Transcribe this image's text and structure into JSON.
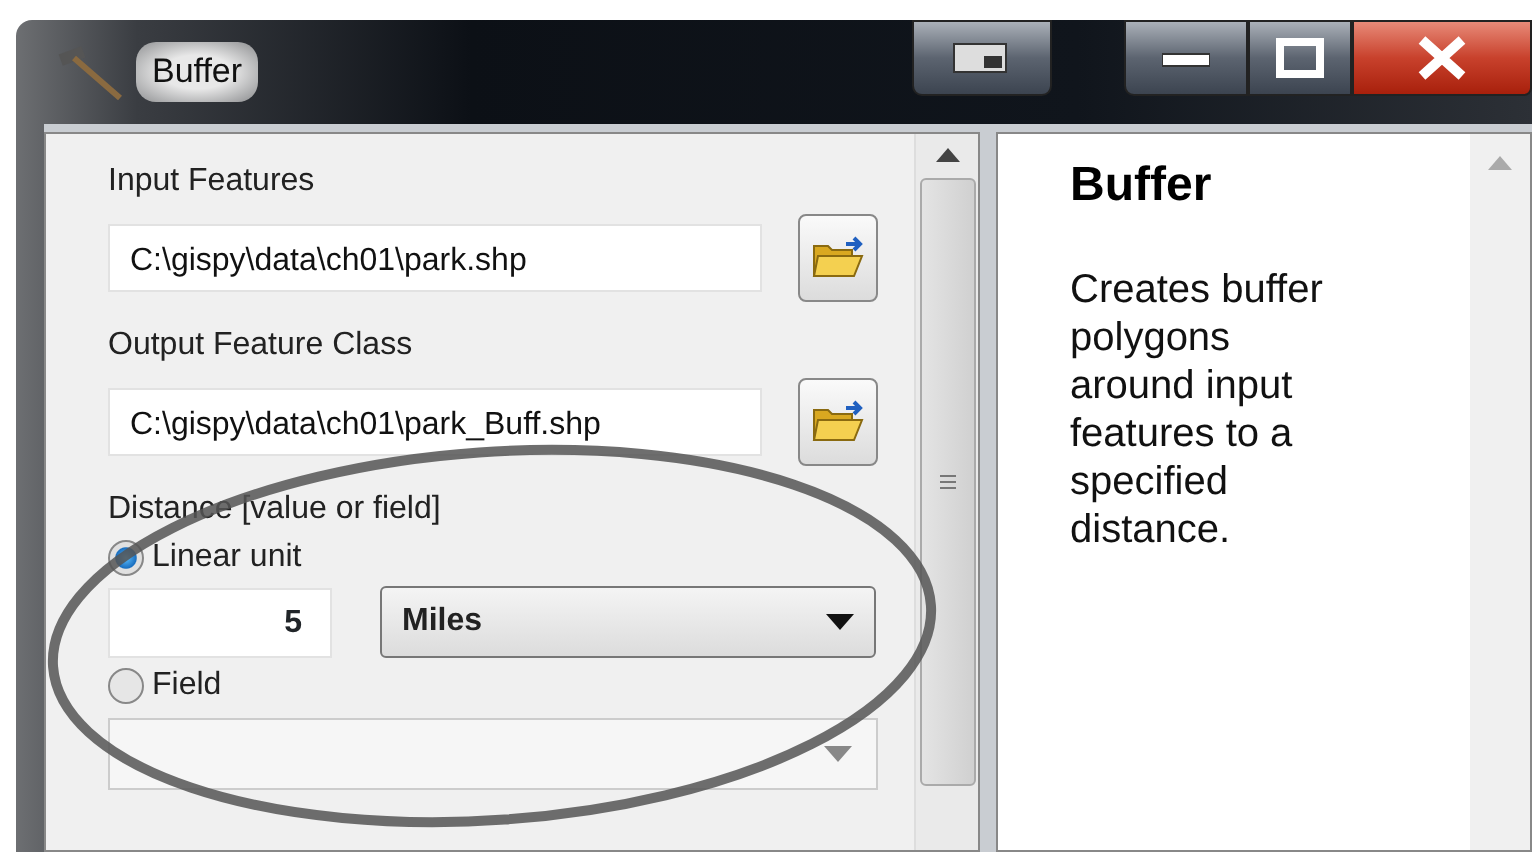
{
  "window": {
    "title": "Buffer"
  },
  "form": {
    "fields": [
      {
        "kind": "path",
        "label": "Input Features",
        "value": "C:\\gispy\\data\\ch01\\park.shp"
      },
      {
        "kind": "path",
        "label": "Output Feature Class",
        "value": "C:\\gispy\\data\\ch01\\park_Buff.shp"
      }
    ],
    "distance": {
      "label": "Distance [value or field]",
      "options": [
        {
          "label": "Linear unit",
          "selected": true
        },
        {
          "label": "Field",
          "selected": false
        }
      ],
      "value": "5",
      "unit": "Miles"
    }
  },
  "help": {
    "title": "Buffer",
    "description_lines": [
      "Creates buffer",
      "polygons",
      "around input",
      "features to a",
      "specified",
      "distance."
    ]
  }
}
